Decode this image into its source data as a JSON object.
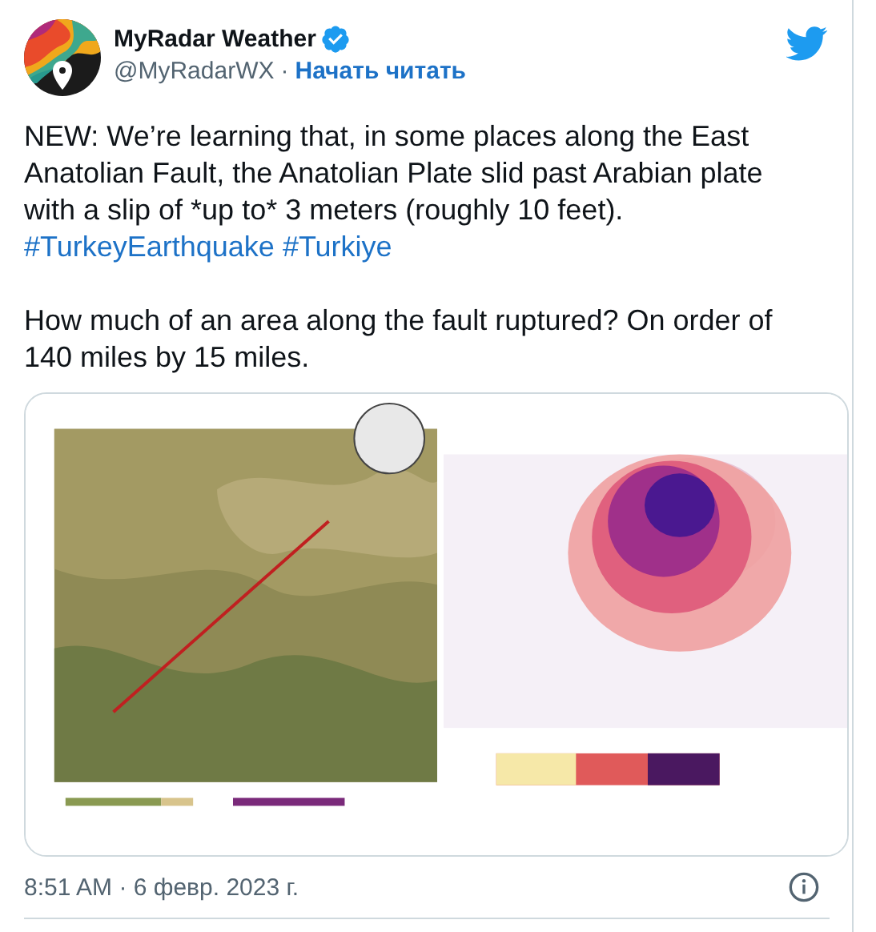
{
  "author": {
    "name": "MyRadar Weather",
    "verified": true,
    "handle": "@MyRadarWX",
    "separator": "·",
    "follow": "Начать читать"
  },
  "paragraphs": [
    [
      {
        "kind": "text",
        "text": "NEW: We’re learning that, in some places along the East Anatolian Fault, the Anatolian Plate slid past Arabian plate with a slip of *up to* 3 meters (roughly 10 feet). "
      },
      {
        "kind": "hashtag",
        "text": "#TurkeyEarthquake"
      },
      {
        "kind": "hashtag",
        "text": "#Turkiye"
      }
    ],
    [
      {
        "kind": "text",
        "text": "How much of an area along the fault ruptured? On order of 140 miles by 15 miles."
      }
    ]
  ],
  "media": {
    "kind": "picture"
  },
  "timestamp": "8:51 AM · 6 февр. 2023 г."
}
